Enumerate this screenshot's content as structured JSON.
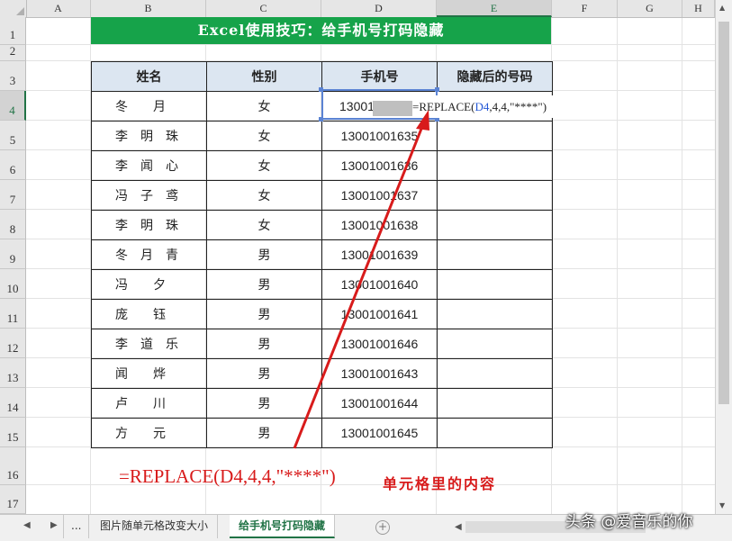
{
  "columns": [
    "A",
    "B",
    "C",
    "D",
    "E",
    "F",
    "G",
    "H"
  ],
  "rows": [
    "1",
    "2",
    "3",
    "4",
    "5",
    "6",
    "7",
    "8",
    "9",
    "10",
    "11",
    "12",
    "13",
    "14",
    "15",
    "16",
    "17"
  ],
  "title": "Excel使用技巧：给手机号打码隐藏",
  "table": {
    "headers": [
      "姓名",
      "性别",
      "手机号",
      "隐藏后的号码"
    ],
    "rows": [
      {
        "name": "冬　　月",
        "gender": "女",
        "phone": "13001"
      },
      {
        "name": "李　明　珠",
        "gender": "女",
        "phone": "13001001635"
      },
      {
        "name": "李　闻　心",
        "gender": "女",
        "phone": "13001001636"
      },
      {
        "name": "冯　子　鸢",
        "gender": "女",
        "phone": "13001001637"
      },
      {
        "name": "李　明　珠",
        "gender": "女",
        "phone": "13001001638"
      },
      {
        "name": "冬　月　青",
        "gender": "男",
        "phone": "13001001639"
      },
      {
        "name": "冯　　夕",
        "gender": "男",
        "phone": "13001001640"
      },
      {
        "name": "庞　　钰",
        "gender": "男",
        "phone": "13001001641"
      },
      {
        "name": "李　道　乐",
        "gender": "男",
        "phone": "13001001646"
      },
      {
        "name": "闻　　烨",
        "gender": "男",
        "phone": "13001001643"
      },
      {
        "name": "卢　　川",
        "gender": "男",
        "phone": "13001001644"
      },
      {
        "name": "方　　元",
        "gender": "男",
        "phone": "13001001645"
      }
    ]
  },
  "formula": {
    "prefix": "=REPLACE(",
    "ref": "D4",
    "suffix": ",4,4,\"****\")"
  },
  "annotation": {
    "formula_text": "=REPLACE(D4,4,4,\"****\")",
    "note": "单元格里的内容"
  },
  "tabs": {
    "ellipsis": "...",
    "sheet1": "图片随单元格改变大小",
    "sheet2": "给手机号打码隐藏",
    "add": "+"
  },
  "watermark": "头条 @爱音乐的你",
  "colors": {
    "title_bg": "#16a34a",
    "header_bg": "#dce6f1",
    "accent": "#217346",
    "arrow": "#d81b1b"
  }
}
